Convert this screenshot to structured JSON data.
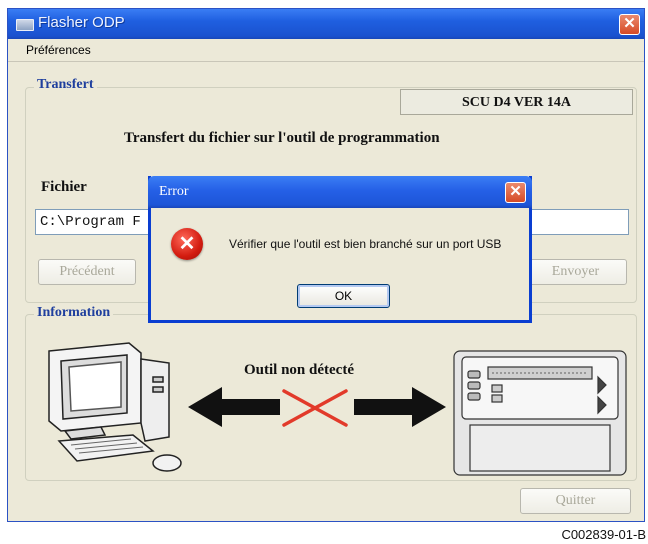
{
  "window": {
    "title": "Flasher ODP",
    "close_glyph": "✕"
  },
  "menu": {
    "items": [
      "Préférences"
    ]
  },
  "transfer": {
    "group_label": "Transfert",
    "version": "SCU D4 VER  14A",
    "instruction": "Transfert du fichier sur l'outil de programmation",
    "file_label": "Fichier",
    "file_path": "C:\\Program F",
    "prev_button": "Précédent",
    "send_button": "Envoyer"
  },
  "information": {
    "group_label": "Information",
    "status": "Outil non détecté",
    "quit_button": "Quitter"
  },
  "dialog": {
    "title": "Error",
    "close_glyph": "✕",
    "icon": "error-icon",
    "message": "Vérifier que l'outil est bien branché sur un port USB",
    "ok_button": "OK"
  },
  "caption": "C002839-01-B",
  "colors": {
    "title_blue": "#1f5fe0",
    "group_label": "#1f3f9e",
    "error_red": "#d31c10",
    "window_bg": "#ece9d8"
  }
}
